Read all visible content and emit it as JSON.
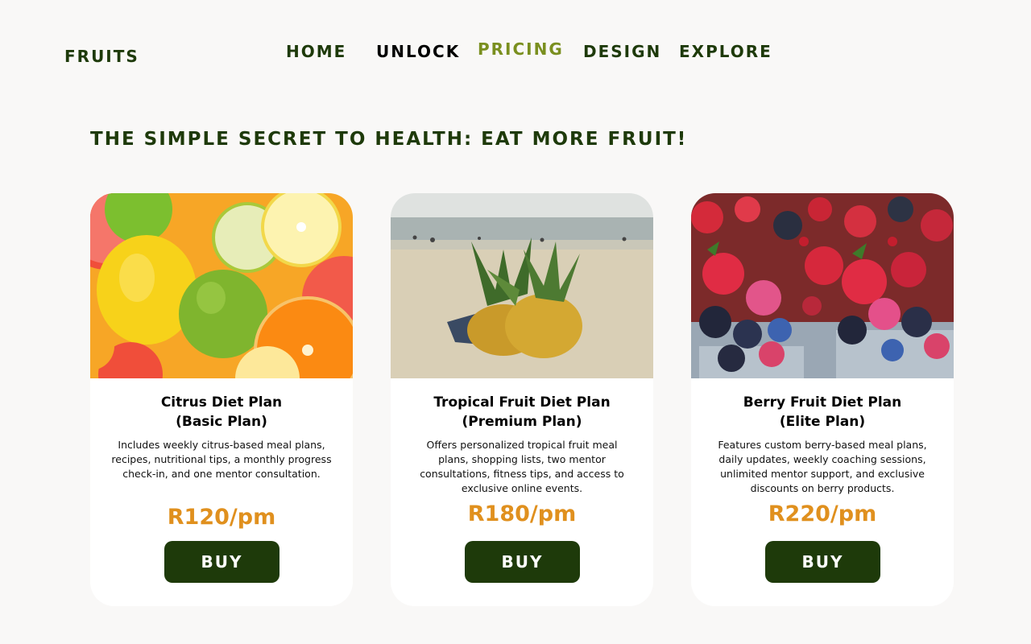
{
  "brand": {
    "logo": "FRUITS"
  },
  "nav": {
    "items": [
      {
        "label": "HOME"
      },
      {
        "label": "UNLOCK"
      },
      {
        "label": "PRICING",
        "active": true
      },
      {
        "label": "DESIGN"
      },
      {
        "label": "EXPLORE"
      }
    ]
  },
  "headline": "THE SIMPLE SECRET TO HEALTH: EAT MORE FRUIT!",
  "plans": [
    {
      "title_line1": "Citrus Diet Plan",
      "title_line2": "(Basic Plan)",
      "description": "Includes weekly citrus-based meal plans, recipes, nutritional tips, a monthly progress check-in, and one mentor consultation.",
      "price": "R120/pm",
      "buy_label": "BUY",
      "image": "citrus-fruits-photo"
    },
    {
      "title_line1": "Tropical Fruit Diet Plan",
      "title_line2": "(Premium Plan)",
      "description": "Offers personalized tropical fruit meal plans, shopping lists, two mentor consultations, fitness tips, and access to exclusive online events.",
      "price": "R180/pm",
      "buy_label": "BUY",
      "image": "pineapples-on-beach-photo"
    },
    {
      "title_line1": "Berry Fruit Diet Plan",
      "title_line2": "(Elite Plan)",
      "description": "Features custom berry-based meal plans, daily updates, weekly coaching sessions, unlimited mentor support, and exclusive discounts on berry products.",
      "price": "R220/pm",
      "buy_label": "BUY",
      "image": "berries-in-punnets-photo"
    }
  ],
  "colors": {
    "background": "#f9f8f7",
    "brand_green": "#1e3a0a",
    "active_nav": "#7a8f1f",
    "price_orange": "#e0901e",
    "card": "#ffffff"
  }
}
